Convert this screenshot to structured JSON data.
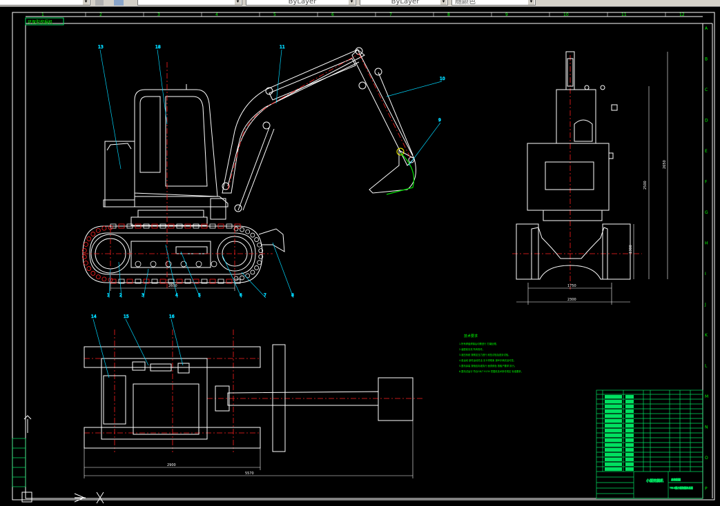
{
  "toolbar": {
    "layer_value": "ByLayer",
    "linetype_value": "ByLayer",
    "color_value": "随颜色",
    "layer_combo_text": "",
    "style_combo_text": ""
  },
  "drawing": {
    "stamp_text": "环保型挖掘机",
    "grid_cols_top": [
      "1",
      "2",
      "3",
      "4",
      "5",
      "6",
      "7",
      "8",
      "9",
      "10",
      "11",
      "12"
    ],
    "grid_rows_right": [
      "A",
      "B",
      "C",
      "D",
      "E",
      "F",
      "G",
      "H",
      "I",
      "J",
      "K",
      "L",
      "M",
      "N",
      "O",
      "P"
    ],
    "callouts_side": [
      "13",
      "18",
      "11",
      "10",
      "9",
      "1",
      "2",
      "3",
      "4",
      "5",
      "6",
      "7",
      "8"
    ],
    "callouts_top": [
      "14",
      "15",
      "16"
    ],
    "dims_side": [
      "2600"
    ],
    "dims_front": [
      "1750",
      "2300"
    ],
    "dims_front_vertical": [
      "2500",
      "2650",
      "1300"
    ],
    "dims_top": [
      "2900",
      "5570"
    ],
    "notes_title": "技术要求",
    "notes_lines": [
      "1.所有焊缝焊接后均需进行 打磨处理。",
      "2.装配前清洗 所有零件。",
      "3.液压系统 按规定压力进行 耐压试验及密封试验。",
      "4.各运动 部件运动灵活 无卡滞现象 操纵手柄灵活可靠。",
      "5.整机涂装 按相应标准执行 面漆颜色 按客户要求 执行。",
      "6.整机试运行 符合GB/T 9139 挖掘机技术条件规定 标准要求。"
    ],
    "title_block": {
      "drawing_name": "小型挖掘机",
      "scale_label": "总装配图",
      "designer_label": "YW-3型小型挖掘机总图"
    }
  },
  "colors": {
    "outline": "#ffffff",
    "frame": "#ffffff",
    "center": "#ff2020",
    "leader": "#00d8ff",
    "dimension": "#00e000",
    "note": "#00ff00",
    "table": "#00e060",
    "accent_yellow": "#ffff00"
  }
}
